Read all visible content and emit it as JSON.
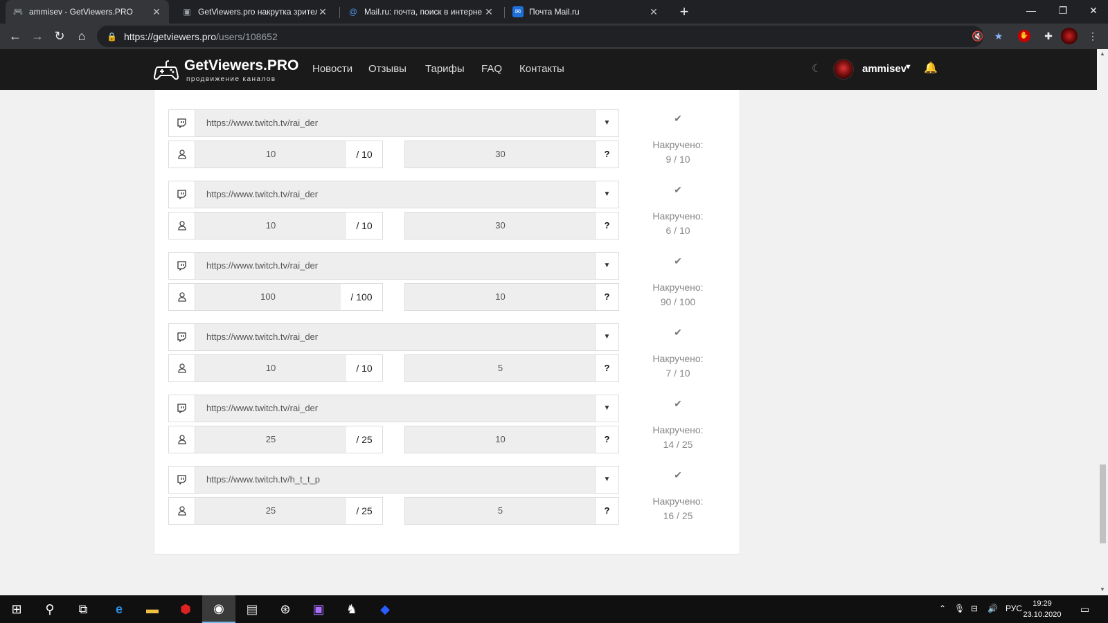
{
  "browser": {
    "tabs": [
      {
        "title": "ammisev - GetViewers.PRO",
        "active": true,
        "icon": "gamepad-icon"
      },
      {
        "title": "GetViewers.pro накрутка зрител",
        "active": false,
        "icon": "twitch-icon"
      },
      {
        "title": "Mail.ru: почта, поиск в интерне",
        "active": false,
        "icon": "at-icon"
      },
      {
        "title": "Почта Mail.ru",
        "active": false,
        "icon": "mail-icon"
      }
    ],
    "url_host": "https://getviewers.pro",
    "url_path": "/users/108652"
  },
  "site": {
    "logo_main": "GetViewers.PRO",
    "logo_sub": "продвижение каналов",
    "nav": [
      "Новости",
      "Отзывы",
      "Тарифы",
      "FAQ",
      "Контакты"
    ],
    "username": "ammisev"
  },
  "orders": [
    {
      "url": "https://www.twitch.tv/rai_der",
      "viewers": "10",
      "max": "/ 10",
      "time": "30",
      "status_label": "Накручено:",
      "progress": "9 / 10"
    },
    {
      "url": "https://www.twitch.tv/rai_der",
      "viewers": "10",
      "max": "/ 10",
      "time": "30",
      "status_label": "Накручено:",
      "progress": "6 / 10"
    },
    {
      "url": "https://www.twitch.tv/rai_der",
      "viewers": "100",
      "max": "/ 100",
      "time": "10",
      "status_label": "Накручено:",
      "progress": "90 / 100"
    },
    {
      "url": "https://www.twitch.tv/rai_der",
      "viewers": "10",
      "max": "/ 10",
      "time": "5",
      "status_label": "Накручено:",
      "progress": "7 / 10"
    },
    {
      "url": "https://www.twitch.tv/rai_der",
      "viewers": "25",
      "max": "/ 25",
      "time": "10",
      "status_label": "Накручено:",
      "progress": "14 / 25"
    },
    {
      "url": "https://www.twitch.tv/h_t_t_p",
      "viewers": "25",
      "max": "/ 25",
      "time": "5",
      "status_label": "Накручено:",
      "progress": "16 / 25"
    }
  ],
  "order_help": "?",
  "taskbar": {
    "lang": "РУС",
    "time": "19:29",
    "date": "23.10.2020"
  }
}
